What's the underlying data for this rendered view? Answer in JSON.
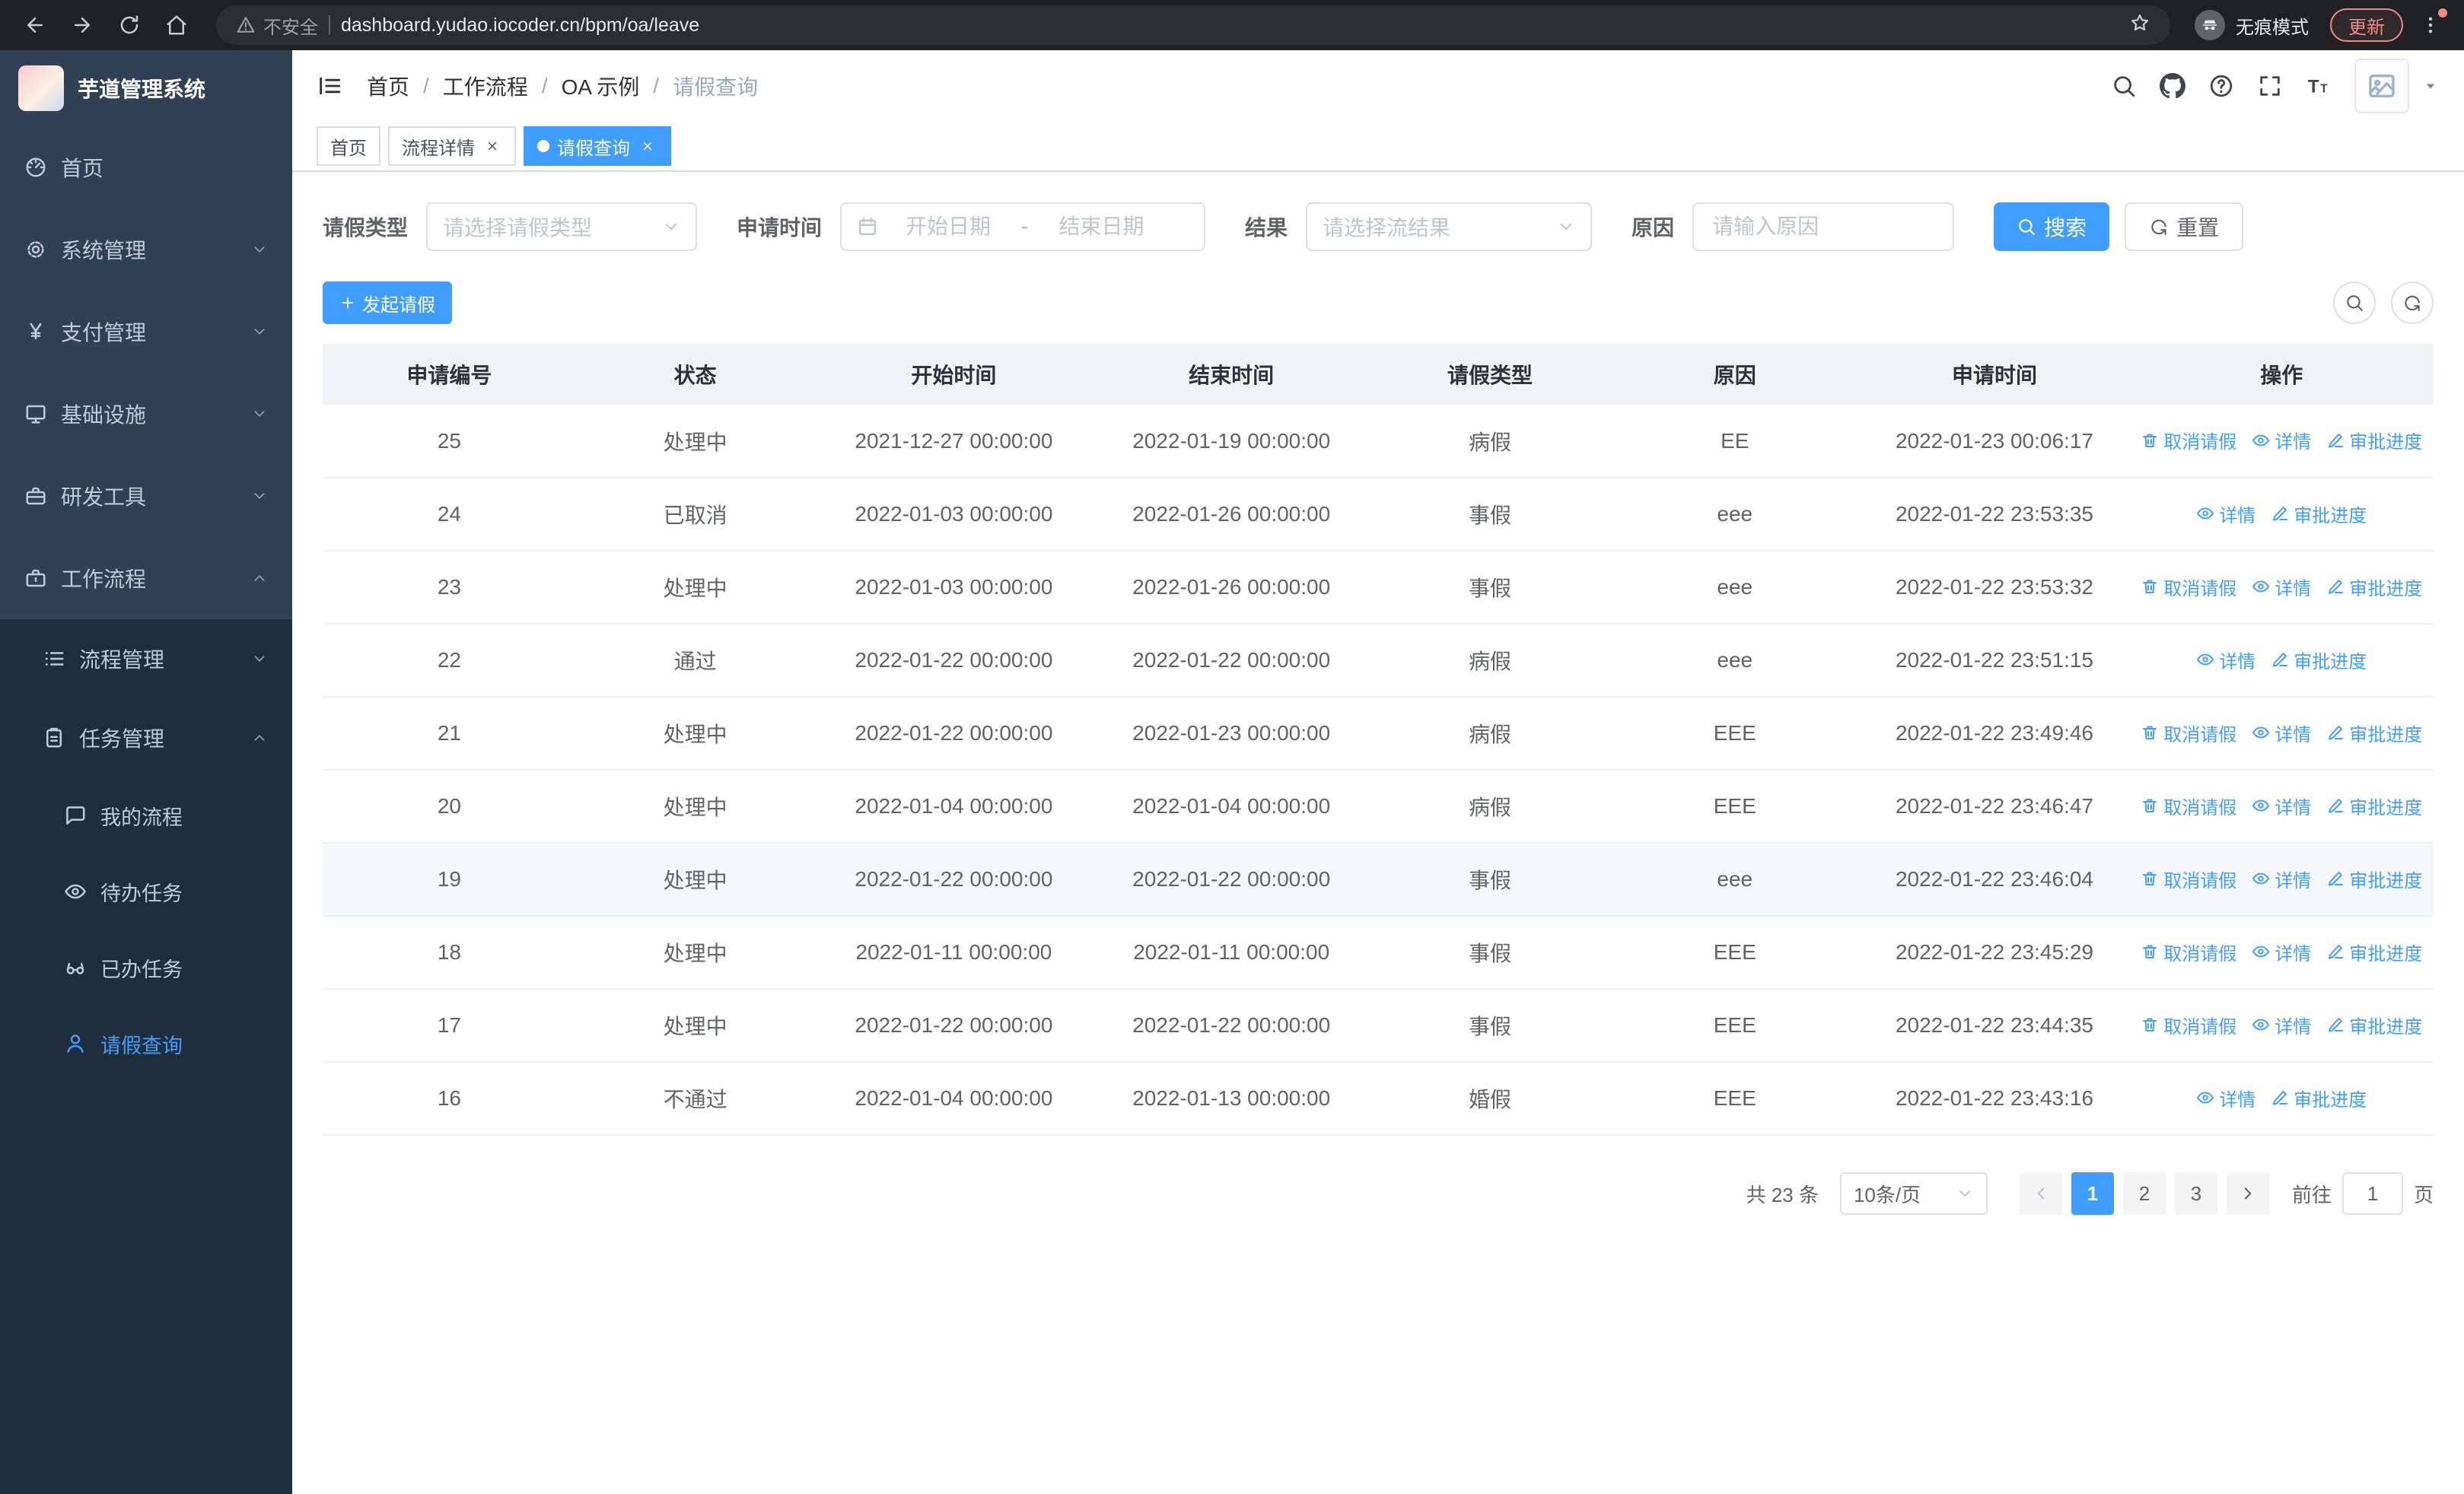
{
  "colors": {
    "accent": "#409eff",
    "chrome_bg": "#202124",
    "sidebar_bg": "#304156",
    "submenu_bg": "#1f2d3d",
    "table_header_bg": "#f2f3f5",
    "update_red": "#f28b82"
  },
  "browser": {
    "security_label": "不安全",
    "url": "dashboard.yudao.iocoder.cn/bpm/oa/leave",
    "incognito_label": "无痕模式",
    "update_label": "更新"
  },
  "sidebar": {
    "logo_title": "芋道管理系统",
    "items": [
      {
        "key": "home",
        "label": "首页",
        "icon": "dashboard-icon",
        "level": 1
      },
      {
        "key": "system-management",
        "label": "系统管理",
        "icon": "gear-icon",
        "level": 1,
        "chevron": "down"
      },
      {
        "key": "payment-management",
        "label": "支付管理",
        "icon": "yen-icon",
        "level": 1,
        "chevron": "down"
      },
      {
        "key": "infrastructure",
        "label": "基础设施",
        "icon": "monitor-icon",
        "level": 1,
        "chevron": "down"
      },
      {
        "key": "dev-tools",
        "label": "研发工具",
        "icon": "toolbox-icon",
        "level": 1,
        "chevron": "down"
      },
      {
        "key": "workflow",
        "label": "工作流程",
        "icon": "briefcase-icon",
        "level": 1,
        "chevron": "up"
      },
      {
        "key": "process-management",
        "label": "流程管理",
        "icon": "list-icon",
        "level": 2,
        "chevron": "down"
      },
      {
        "key": "task-management",
        "label": "任务管理",
        "icon": "clipboard-icon",
        "level": 2,
        "chevron": "up"
      },
      {
        "key": "my-processes",
        "label": "我的流程",
        "icon": "chat-icon",
        "level": 3
      },
      {
        "key": "todo-tasks",
        "label": "待办任务",
        "icon": "eye-icon",
        "level": 3
      },
      {
        "key": "done-tasks",
        "label": "已办任务",
        "icon": "glasses-icon",
        "level": 3
      },
      {
        "key": "leave-query",
        "label": "请假查询",
        "icon": "user-icon",
        "level": 3,
        "active": true
      }
    ]
  },
  "header": {
    "breadcrumb": [
      {
        "label": "首页"
      },
      {
        "label": "工作流程"
      },
      {
        "label": "OA 示例"
      },
      {
        "label": "请假查询",
        "current": true
      }
    ]
  },
  "tabs": [
    {
      "label": "首页"
    },
    {
      "label": "流程详情",
      "closable": true
    },
    {
      "label": "请假查询",
      "closable": true,
      "active": true
    }
  ],
  "filters": {
    "leave_type_label": "请假类型",
    "leave_type_placeholder": "请选择请假类型",
    "apply_time_label": "申请时间",
    "start_placeholder": "开始日期",
    "range_separator": "-",
    "end_placeholder": "结束日期",
    "result_label": "结果",
    "result_placeholder": "请选择流结果",
    "reason_label": "原因",
    "reason_placeholder": "请输入原因",
    "search_label": "搜索",
    "reset_label": "重置"
  },
  "toolbar": {
    "create_label": "发起请假"
  },
  "table": {
    "columns": [
      "申请编号",
      "状态",
      "开始时间",
      "结束时间",
      "请假类型",
      "原因",
      "申请时间",
      "操作"
    ],
    "action_labels": {
      "cancel": "取消请假",
      "detail": "详情",
      "progress": "审批进度"
    },
    "rows": [
      {
        "id": "25",
        "status": "处理中",
        "start": "2021-12-27 00:00:00",
        "end": "2022-01-19 00:00:00",
        "type": "病假",
        "reason": "EE",
        "applied": "2022-01-23 00:06:17",
        "actions": [
          "cancel",
          "detail",
          "progress"
        ]
      },
      {
        "id": "24",
        "status": "已取消",
        "start": "2022-01-03 00:00:00",
        "end": "2022-01-26 00:00:00",
        "type": "事假",
        "reason": "eee",
        "applied": "2022-01-22 23:53:35",
        "actions": [
          "detail",
          "progress"
        ]
      },
      {
        "id": "23",
        "status": "处理中",
        "start": "2022-01-03 00:00:00",
        "end": "2022-01-26 00:00:00",
        "type": "事假",
        "reason": "eee",
        "applied": "2022-01-22 23:53:32",
        "actions": [
          "cancel",
          "detail",
          "progress"
        ]
      },
      {
        "id": "22",
        "status": "通过",
        "start": "2022-01-22 00:00:00",
        "end": "2022-01-22 00:00:00",
        "type": "病假",
        "reason": "eee",
        "applied": "2022-01-22 23:51:15",
        "actions": [
          "detail",
          "progress"
        ]
      },
      {
        "id": "21",
        "status": "处理中",
        "start": "2022-01-22 00:00:00",
        "end": "2022-01-23 00:00:00",
        "type": "病假",
        "reason": "EEE",
        "applied": "2022-01-22 23:49:46",
        "actions": [
          "cancel",
          "detail",
          "progress"
        ]
      },
      {
        "id": "20",
        "status": "处理中",
        "start": "2022-01-04 00:00:00",
        "end": "2022-01-04 00:00:00",
        "type": "病假",
        "reason": "EEE",
        "applied": "2022-01-22 23:46:47",
        "actions": [
          "cancel",
          "detail",
          "progress"
        ]
      },
      {
        "id": "19",
        "status": "处理中",
        "start": "2022-01-22 00:00:00",
        "end": "2022-01-22 00:00:00",
        "type": "事假",
        "reason": "eee",
        "applied": "2022-01-22 23:46:04",
        "actions": [
          "cancel",
          "detail",
          "progress"
        ],
        "highlight": true
      },
      {
        "id": "18",
        "status": "处理中",
        "start": "2022-01-11 00:00:00",
        "end": "2022-01-11 00:00:00",
        "type": "事假",
        "reason": "EEE",
        "applied": "2022-01-22 23:45:29",
        "actions": [
          "cancel",
          "detail",
          "progress"
        ]
      },
      {
        "id": "17",
        "status": "处理中",
        "start": "2022-01-22 00:00:00",
        "end": "2022-01-22 00:00:00",
        "type": "事假",
        "reason": "EEE",
        "applied": "2022-01-22 23:44:35",
        "actions": [
          "cancel",
          "detail",
          "progress"
        ]
      },
      {
        "id": "16",
        "status": "不通过",
        "start": "2022-01-04 00:00:00",
        "end": "2022-01-13 00:00:00",
        "type": "婚假",
        "reason": "EEE",
        "applied": "2022-01-22 23:43:16",
        "actions": [
          "detail",
          "progress"
        ]
      }
    ]
  },
  "pagination": {
    "total_label": "共 23 条",
    "page_size_value": "10条/页",
    "pages": [
      "1",
      "2",
      "3"
    ],
    "active_page": "1",
    "goto_label": "前往",
    "goto_value": "1",
    "page_suffix": "页"
  }
}
